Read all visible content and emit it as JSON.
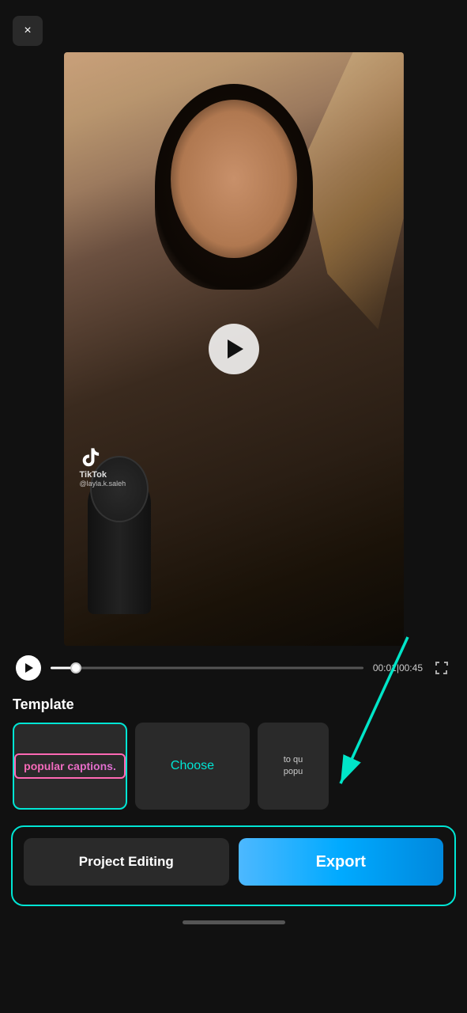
{
  "close_button": "×",
  "video": {
    "tiktok_brand": "TikTok",
    "tiktok_handle": "@layla.k.saleh",
    "time_current": "00:01",
    "time_total": "00:45",
    "time_display": "00:01|00:45"
  },
  "template": {
    "label": "Template",
    "card1_text": "popular captions.",
    "card2_text": "Choose",
    "card3_line1": "to qu",
    "card3_line2": "popu"
  },
  "actions": {
    "project_editing": "Project Editing",
    "export": "Export"
  }
}
